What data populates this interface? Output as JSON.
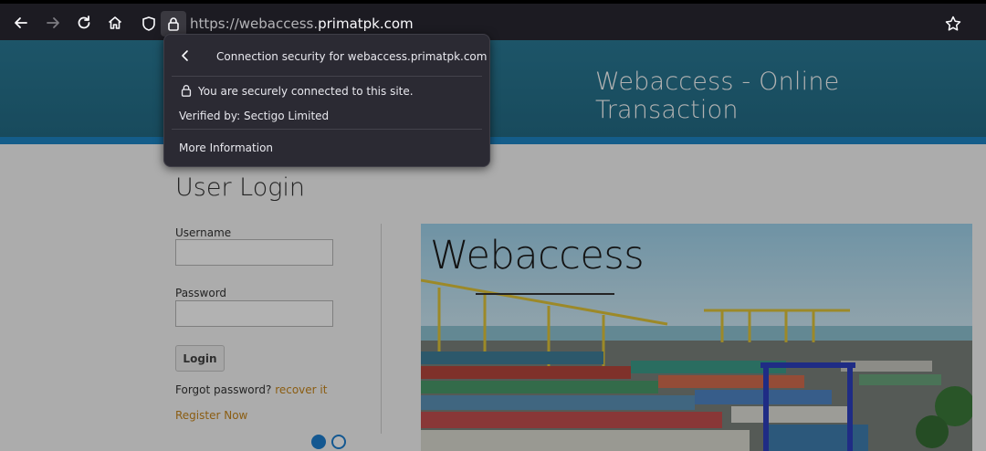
{
  "browser": {
    "url_prefix": "https://webaccess.",
    "url_host": "primatpk.com",
    "icons": {
      "back": "back-arrow-icon",
      "forward": "forward-arrow-icon",
      "reload": "reload-icon",
      "home": "home-icon",
      "shield": "shield-icon",
      "lock": "lock-icon",
      "bookmark": "star-icon"
    }
  },
  "popup": {
    "title": "Connection security for webaccess.primatpk.com",
    "secure_text": "You are securely connected to this site.",
    "verified_text": "Verified by: Sectigo Limited",
    "more_info": "More Information"
  },
  "site": {
    "header_title": "Webaccess - Online Transaction",
    "accent_color": "#236b85",
    "stripe_color": "#1d86c6"
  },
  "login": {
    "heading": "User Login",
    "username_label": "Username",
    "username_value": "",
    "password_label": "Password",
    "password_value": "",
    "login_button": "Login",
    "forgot_text": "Forgot password?",
    "recover_link": "recover it",
    "register_link": "Register Now",
    "link_color": "#c7861b"
  },
  "banner": {
    "title": "Webaccess"
  },
  "carousel": {
    "active_index": 0,
    "count": 2
  }
}
